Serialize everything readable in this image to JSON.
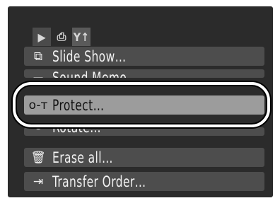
{
  "tabs": [
    {
      "icon": "play-icon",
      "glyph": "▶"
    },
    {
      "icon": "print-icon",
      "glyph": "⎙"
    },
    {
      "icon": "settings-icon",
      "glyph": "Y↑"
    }
  ],
  "menu": {
    "items": [
      {
        "icon": "slideshow-icon",
        "glyph": "⧉",
        "label": "Slide Show…"
      },
      {
        "icon": "sound-memo-icon",
        "glyph": "▭",
        "label": "Sound Memo…"
      },
      {
        "icon": "key-icon",
        "glyph": "o-т",
        "label": "Protect…"
      },
      {
        "icon": "rotate-icon",
        "glyph": "↻",
        "label": "Rotate…"
      },
      {
        "icon": "trash-icon",
        "glyph": "🗑",
        "label": "Erase all…"
      },
      {
        "icon": "transfer-icon",
        "glyph": "⇥",
        "label": "Transfer Order…"
      }
    ]
  }
}
